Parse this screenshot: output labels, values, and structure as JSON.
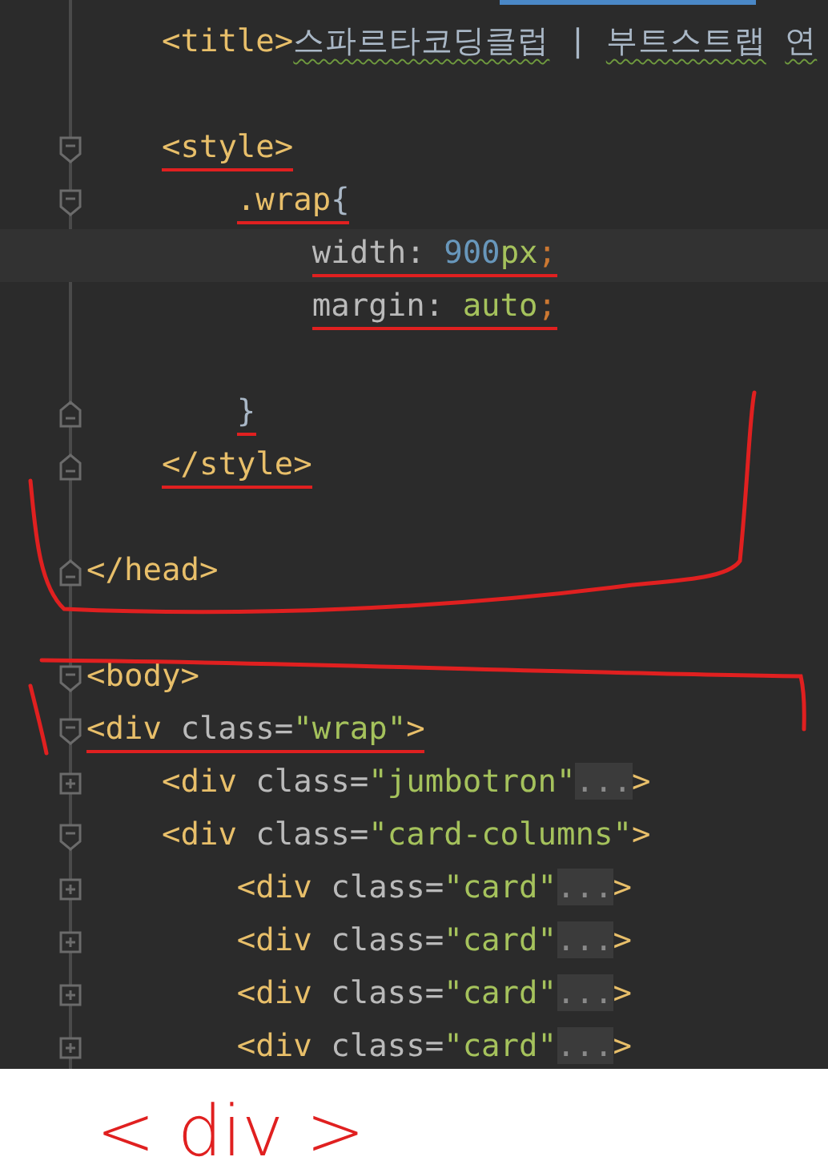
{
  "editor": {
    "lines": [
      {
        "current": false,
        "underlined": false,
        "tokens": [
          {
            "kind": "tag",
            "text": "    <title>"
          },
          {
            "kind": "misspelled",
            "text": "스파르타코딩클럽"
          },
          {
            "kind": "text",
            "text": " | "
          },
          {
            "kind": "misspelled",
            "text": "부트스트랩 "
          },
          {
            "kind": "misspelled",
            "text": "연"
          }
        ]
      },
      {
        "current": false
      },
      {
        "fold_marker": {
          "kind": "start"
        },
        "current": false,
        "underlined": true,
        "tokens": [
          {
            "kind": "tag",
            "text": "    <style>"
          }
        ]
      },
      {
        "fold_marker": {
          "kind": "start"
        },
        "current": false,
        "underlined": true,
        "tokens": [
          {
            "kind": "tag",
            "text": "        .wrap"
          },
          {
            "kind": "brace",
            "text": "{"
          }
        ]
      },
      {
        "current": true,
        "underlined": true,
        "tokens": [
          {
            "kind": "prop",
            "text": "            width: "
          },
          {
            "kind": "number",
            "text": "900"
          },
          {
            "kind": "value",
            "text": "px"
          },
          {
            "kind": "punct",
            "text": ";"
          }
        ]
      },
      {
        "current": false,
        "underlined": true,
        "tokens": [
          {
            "kind": "prop",
            "text": "            margin: "
          },
          {
            "kind": "value",
            "text": "auto"
          },
          {
            "kind": "punct",
            "text": ";"
          }
        ]
      },
      {
        "current": false
      },
      {
        "fold_marker": {
          "kind": "end"
        },
        "current": false,
        "underlined": true,
        "tokens": [
          {
            "kind": "brace",
            "text": "        }"
          }
        ]
      },
      {
        "fold_marker": {
          "kind": "end"
        },
        "current": false,
        "underlined": true,
        "tokens": [
          {
            "kind": "tag",
            "text": "    </style>"
          }
        ]
      },
      {
        "current": false
      },
      {
        "fold_marker": {
          "kind": "end"
        },
        "current": false,
        "underlined": false,
        "tokens": [
          {
            "kind": "tag",
            "text": "</head>"
          }
        ]
      },
      {
        "current": false
      },
      {
        "fold_marker": {
          "kind": "start"
        },
        "current": false,
        "underlined": false,
        "tokens": [
          {
            "kind": "tag",
            "text": "<body>"
          }
        ]
      },
      {
        "fold_marker": {
          "kind": "start"
        },
        "current": false,
        "underlined": true,
        "tokens": [
          {
            "kind": "tag",
            "text": "<div "
          },
          {
            "kind": "attr",
            "text": "class="
          },
          {
            "kind": "value",
            "text": "\"wrap\""
          },
          {
            "kind": "tag",
            "text": ">"
          }
        ]
      },
      {
        "fold_marker": {
          "kind": "collapsed"
        },
        "current": false,
        "underlined": false,
        "tokens": [
          {
            "kind": "tag",
            "text": "    <div "
          },
          {
            "kind": "attr",
            "text": "class="
          },
          {
            "kind": "value",
            "text": "\"jumbotron\""
          },
          {
            "kind": "placeholder",
            "text": "..."
          },
          {
            "kind": "tag",
            "text": ">"
          }
        ]
      },
      {
        "fold_marker": {
          "kind": "start"
        },
        "current": false,
        "underlined": false,
        "tokens": [
          {
            "kind": "tag",
            "text": "    <div "
          },
          {
            "kind": "attr",
            "text": "class="
          },
          {
            "kind": "value",
            "text": "\"card-columns\""
          },
          {
            "kind": "tag",
            "text": ">"
          }
        ]
      },
      {
        "fold_marker": {
          "kind": "collapsed"
        },
        "current": false,
        "underlined": false,
        "tokens": [
          {
            "kind": "tag",
            "text": "        <div "
          },
          {
            "kind": "attr",
            "text": "class="
          },
          {
            "kind": "value",
            "text": "\"card\""
          },
          {
            "kind": "placeholder",
            "text": "..."
          },
          {
            "kind": "tag",
            "text": ">"
          }
        ]
      },
      {
        "fold_marker": {
          "kind": "collapsed"
        },
        "current": false,
        "underlined": false,
        "tokens": [
          {
            "kind": "tag",
            "text": "        <div "
          },
          {
            "kind": "attr",
            "text": "class="
          },
          {
            "kind": "value",
            "text": "\"card\""
          },
          {
            "kind": "placeholder",
            "text": "..."
          },
          {
            "kind": "tag",
            "text": ">"
          }
        ]
      },
      {
        "fold_marker": {
          "kind": "collapsed"
        },
        "current": false,
        "underlined": false,
        "tokens": [
          {
            "kind": "tag",
            "text": "        <div "
          },
          {
            "kind": "attr",
            "text": "class="
          },
          {
            "kind": "value",
            "text": "\"card\""
          },
          {
            "kind": "placeholder",
            "text": "..."
          },
          {
            "kind": "tag",
            "text": ">"
          }
        ]
      },
      {
        "fold_marker": {
          "kind": "collapsed"
        },
        "current": false,
        "underlined": false,
        "tokens": [
          {
            "kind": "tag",
            "text": "        <div "
          },
          {
            "kind": "attr",
            "text": "class="
          },
          {
            "kind": "value",
            "text": "\"card\""
          },
          {
            "kind": "placeholder",
            "text": "..."
          },
          {
            "kind": "tag",
            "text": ">"
          }
        ]
      }
    ]
  },
  "handwritten_note": "< div >"
}
